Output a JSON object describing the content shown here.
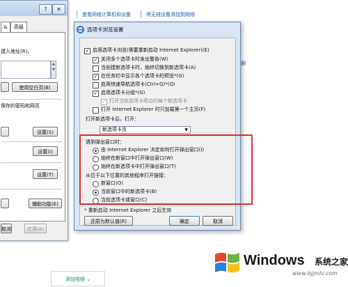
{
  "toolbar_links": [
    "查看网络计算机和设备",
    "将无线设备添加到网络"
  ],
  "side_link": "删",
  "background_window": {
    "title_help": "?",
    "title_close": "✕",
    "tab_fragment": "&",
    "tab_advanced": "高级",
    "homepage_text": "建入地址(R)。",
    "use_blank_button": "使用空白页(B)",
    "history_text": "保存的密码和网页",
    "settings1": "设置(S)",
    "settings2": "设置(I)",
    "settings3": "设置(T)",
    "accessibility_button": "辅助功能(E)",
    "cancel_button": "取消",
    "apply_button": "应用(A)"
  },
  "dialog": {
    "title": "选项卡浏览设置",
    "options": [
      {
        "label": "启用选项卡浏览(需要重新启动 Internet Explorer)(E)",
        "checked": true,
        "disabled": false
      },
      {
        "label": "关闭多个选项卡时发出警告(W)",
        "checked": true,
        "disabled": false
      },
      {
        "label": "当创建新选项卡时，始终切换到新选项卡(A)",
        "checked": false,
        "disabled": false
      },
      {
        "label": "在任务栏中显示各个选项卡的预览*(G)",
        "checked": true,
        "disabled": false
      },
      {
        "label": "启用快速导航选项卡(Ctrl+Q)*(Q)",
        "checked": false,
        "disabled": false
      },
      {
        "label": "启用选项卡分组*(G)",
        "checked": true,
        "disabled": false
      },
      {
        "label": "打开当前选项卡旁边的每个新选项卡",
        "checked": true,
        "disabled": true
      },
      {
        "label": "打开 Internet Explorer 时只加载第一个主页(F)",
        "checked": false,
        "disabled": false
      }
    ],
    "new_tab_label": "打开新选项卡后，打开：",
    "new_tab_select": "新选项卡页",
    "popup_group_label": "遇到弹出窗口时：",
    "popup_options": [
      {
        "label": "由 Internet Explorer 决定如何打开弹出窗口(I)",
        "selected": true
      },
      {
        "label": "始终在新窗口中打开弹出窗口(W)",
        "selected": false
      },
      {
        "label": "始终在新选项卡中打开弹出窗口(T)",
        "selected": false
      }
    ],
    "external_group_label": "从位于以下位置的其他程序打开链接：",
    "external_options": [
      {
        "label": "新窗口(O)",
        "selected": false
      },
      {
        "label": "当前窗口中的新选项卡(B)",
        "selected": true
      },
      {
        "label": "当前选项卡或窗口(C)",
        "selected": false
      }
    ],
    "note": "* 重新启动 Internet Explorer 之后生效",
    "restore_button": "还原为默认值(R)",
    "ok_button": "确定",
    "cancel_button": "取消"
  },
  "bottom": {
    "add_video": "添加视频 ⌄",
    "brand": "Windows",
    "brand_suffix": "系统之家",
    "watermark": "www.bjjmlv.com"
  },
  "colors": {
    "highlight_box": "#e02a2a",
    "link": "#1d5ab0"
  }
}
